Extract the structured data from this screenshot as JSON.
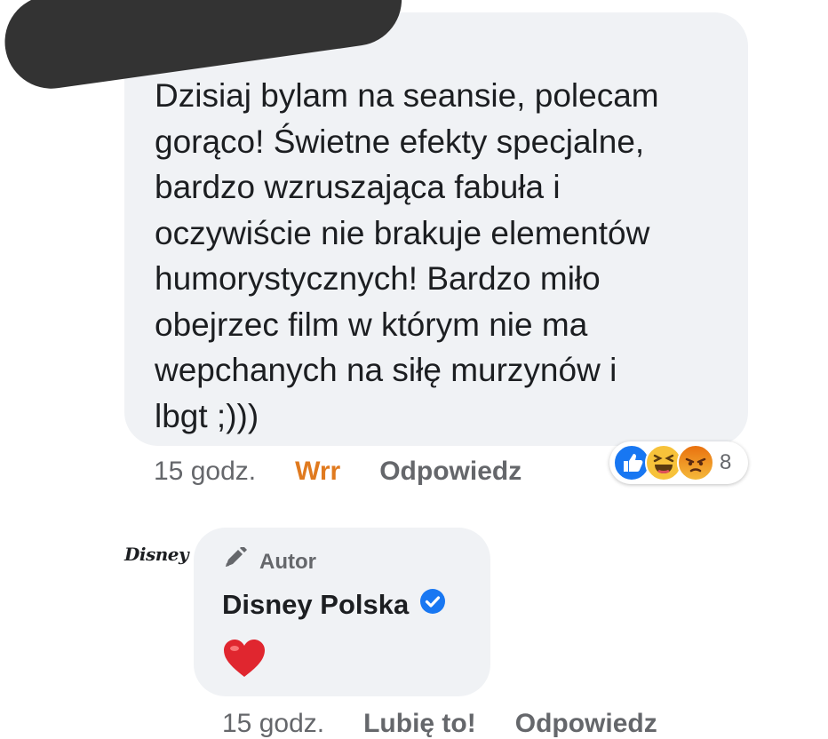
{
  "comment": {
    "text": "Dzisiaj bylam na seansie, polecam\ngorąco! Świetne efekty specjalne,\nbardzo wzruszająca fabuła i\noczywiście nie brakuje elementów\nhumorystycznych! Bardzo miło\nobejrzec film w którym nie ma\nwepchanych na siłę murzynów i\nlbgt ;)))",
    "time": "15 godz.",
    "reaction_label": "Wrr",
    "reply_label": "Odpowiedz",
    "reactions": {
      "icons": [
        "like-icon",
        "haha-icon",
        "angry-icon"
      ],
      "count": "8"
    },
    "colors": {
      "reaction_label": "#e07a1f",
      "bubble": "#f0f2f5"
    }
  },
  "reply": {
    "logo_text": "Disney",
    "badge_label": "Autor",
    "author_name": "Disney Polska",
    "content_icon": "red-heart-emoji",
    "time": "15 godz.",
    "like_label": "Lubię to!",
    "reply_label": "Odpowiedz",
    "colors": {
      "verified": "#1877f2",
      "heart": "#e0262f"
    }
  }
}
